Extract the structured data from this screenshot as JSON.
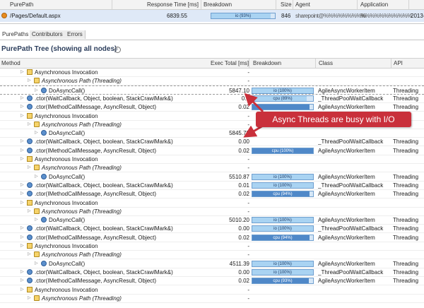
{
  "purepath_table": {
    "columns": [
      "PurePath",
      "Response Time [ms]",
      "Breakdown",
      "Size",
      "Agent",
      "Application"
    ],
    "row": {
      "path": "/Pages/Default.aspx",
      "response_time": "6839.55",
      "breakdown": {
        "label": "io (93%)",
        "kind": "io",
        "fraction": 0.93
      },
      "size": "846",
      "agent": "sharepoint@%%%%%%%%%",
      "application": "%%%%%%%%%%%",
      "extra": "2013-"
    }
  },
  "tabs": [
    {
      "label": "PurePaths",
      "active": true
    },
    {
      "label": "Contributors",
      "active": false
    },
    {
      "label": "Errors",
      "active": false
    }
  ],
  "tree": {
    "title": "PurePath Tree (showing all nodes)",
    "columns": [
      "Method",
      "Exec Total [ms]",
      "Breakdown",
      "Class",
      "API"
    ],
    "rows": [
      {
        "indent": 3,
        "icon": "async",
        "label": "Asynchronous Invocation",
        "italic": false,
        "exec": "-",
        "breakdown": null,
        "class": "",
        "api": ""
      },
      {
        "indent": 4,
        "icon": "path",
        "label": "Asynchronous Path (Threading)",
        "italic": true,
        "exec": "-",
        "breakdown": null,
        "class": "",
        "api": ""
      },
      {
        "indent": 5,
        "icon": "method",
        "label": "DoAsyncCall()",
        "italic": false,
        "exec": "5847.10",
        "breakdown": {
          "label": "io (100%)",
          "kind": "io",
          "fraction": 1.0
        },
        "class": "AgileAsyncWorkerItem",
        "api": "Threading",
        "dashed": true
      },
      {
        "indent": 3,
        "icon": "method",
        "label": ".ctor(WaitCallback, Object, boolean, StackCrawlMark&)",
        "italic": false,
        "exec": "0.0",
        "breakdown": {
          "label": "cpu (89%)",
          "kind": "io",
          "fraction": 0.89
        },
        "class": "_ThreadPoolWaitCallback",
        "api": "Threading"
      },
      {
        "indent": 3,
        "icon": "method",
        "label": ".ctor(IMethodCallMessage, AsyncResult, Object)",
        "italic": false,
        "exec": "0.02",
        "breakdown": {
          "label": "",
          "kind": "cpu",
          "fraction": 0.94
        },
        "class": "AgileAsyncWorkerItem",
        "api": "Threading"
      },
      {
        "indent": 3,
        "icon": "async",
        "label": "Asynchronous Invocation",
        "italic": false,
        "exec": "-",
        "breakdown": null,
        "class": "",
        "api": ""
      },
      {
        "indent": 4,
        "icon": "path",
        "label": "Asynchronous Path (Threading)",
        "italic": true,
        "exec": "-",
        "breakdown": null,
        "class": "",
        "api": ""
      },
      {
        "indent": 5,
        "icon": "method",
        "label": "DoAsyncCall()",
        "italic": false,
        "exec": "5845.73",
        "breakdown": null,
        "class": "",
        "api": ""
      },
      {
        "indent": 3,
        "icon": "method",
        "label": ".ctor(WaitCallback, Object, boolean, StackCrawlMark&)",
        "italic": false,
        "exec": "0.00",
        "breakdown": null,
        "class": "_ThreadPoolWaitCallback",
        "api": "Threading"
      },
      {
        "indent": 3,
        "icon": "method",
        "label": ".ctor(IMethodCallMessage, AsyncResult, Object)",
        "italic": false,
        "exec": "0.02",
        "breakdown": {
          "label": "cpu (100%)",
          "kind": "cpu",
          "fraction": 1.0
        },
        "class": "AgileAsyncWorkerItem",
        "api": "Threading"
      },
      {
        "indent": 3,
        "icon": "async",
        "label": "Asynchronous Invocation",
        "italic": false,
        "exec": "-",
        "breakdown": null,
        "class": "",
        "api": ""
      },
      {
        "indent": 4,
        "icon": "path",
        "label": "Asynchronous Path (Threading)",
        "italic": true,
        "exec": "-",
        "breakdown": null,
        "class": "",
        "api": ""
      },
      {
        "indent": 5,
        "icon": "method",
        "label": "DoAsyncCall()",
        "italic": false,
        "exec": "5510.87",
        "breakdown": {
          "label": "io (100%)",
          "kind": "io",
          "fraction": 1.0
        },
        "class": "AgileAsyncWorkerItem",
        "api": "Threading"
      },
      {
        "indent": 3,
        "icon": "method",
        "label": ".ctor(WaitCallback, Object, boolean, StackCrawlMark&)",
        "italic": false,
        "exec": "0.01",
        "breakdown": {
          "label": "io (100%)",
          "kind": "io",
          "fraction": 1.0
        },
        "class": "_ThreadPoolWaitCallback",
        "api": "Threading"
      },
      {
        "indent": 3,
        "icon": "method",
        "label": ".ctor(IMethodCallMessage, AsyncResult, Object)",
        "italic": false,
        "exec": "0.02",
        "breakdown": {
          "label": "cpu (94%)",
          "kind": "cpu",
          "fraction": 0.94
        },
        "class": "AgileAsyncWorkerItem",
        "api": "Threading"
      },
      {
        "indent": 3,
        "icon": "async",
        "label": "Asynchronous Invocation",
        "italic": false,
        "exec": "-",
        "breakdown": null,
        "class": "",
        "api": ""
      },
      {
        "indent": 4,
        "icon": "path",
        "label": "Asynchronous Path (Threading)",
        "italic": true,
        "exec": "-",
        "breakdown": null,
        "class": "",
        "api": ""
      },
      {
        "indent": 5,
        "icon": "method",
        "label": "DoAsyncCall()",
        "italic": false,
        "exec": "5010.20",
        "breakdown": {
          "label": "io (100%)",
          "kind": "io",
          "fraction": 1.0
        },
        "class": "AgileAsyncWorkerItem",
        "api": "Threading"
      },
      {
        "indent": 3,
        "icon": "method",
        "label": ".ctor(WaitCallback, Object, boolean, StackCrawlMark&)",
        "italic": false,
        "exec": "0.00",
        "breakdown": {
          "label": "io (100%)",
          "kind": "io",
          "fraction": 1.0
        },
        "class": "_ThreadPoolWaitCallback",
        "api": "Threading"
      },
      {
        "indent": 3,
        "icon": "method",
        "label": ".ctor(IMethodCallMessage, AsyncResult, Object)",
        "italic": false,
        "exec": "0.02",
        "breakdown": {
          "label": "cpu (94%)",
          "kind": "cpu",
          "fraction": 0.94
        },
        "class": "AgileAsyncWorkerItem",
        "api": "Threading"
      },
      {
        "indent": 3,
        "icon": "async",
        "label": "Asynchronous Invocation",
        "italic": false,
        "exec": "-",
        "breakdown": null,
        "class": "",
        "api": ""
      },
      {
        "indent": 4,
        "icon": "path",
        "label": "Asynchronous Path (Threading)",
        "italic": true,
        "exec": "-",
        "breakdown": null,
        "class": "",
        "api": ""
      },
      {
        "indent": 5,
        "icon": "method",
        "label": "DoAsyncCall()",
        "italic": false,
        "exec": "4511.39",
        "breakdown": {
          "label": "io (100%)",
          "kind": "io",
          "fraction": 1.0
        },
        "class": "AgileAsyncWorkerItem",
        "api": "Threading"
      },
      {
        "indent": 3,
        "icon": "method",
        "label": ".ctor(WaitCallback, Object, boolean, StackCrawlMark&)",
        "italic": false,
        "exec": "0.00",
        "breakdown": {
          "label": "io (100%)",
          "kind": "io",
          "fraction": 1.0
        },
        "class": "_ThreadPoolWaitCallback",
        "api": "Threading"
      },
      {
        "indent": 3,
        "icon": "method",
        "label": ".ctor(IMethodCallMessage, AsyncResult, Object)",
        "italic": false,
        "exec": "0.02",
        "breakdown": {
          "label": "cpu (93%)",
          "kind": "cpu",
          "fraction": 0.93
        },
        "class": "AgileAsyncWorkerItem",
        "api": "Threading"
      },
      {
        "indent": 3,
        "icon": "async",
        "label": "Asynchronous Invocation",
        "italic": false,
        "exec": "-",
        "breakdown": null,
        "class": "",
        "api": ""
      },
      {
        "indent": 4,
        "icon": "path",
        "label": "Asynchronous Path (Threading)",
        "italic": true,
        "exec": "-",
        "breakdown": null,
        "class": "",
        "api": ""
      }
    ]
  },
  "callout": {
    "text": "Async Threads are busy with I/O"
  },
  "colors": {
    "io": "#a9d3f2",
    "cpu": "#4f88c8",
    "callout": "#c9303b",
    "selected_row": "#dfe9f7"
  }
}
